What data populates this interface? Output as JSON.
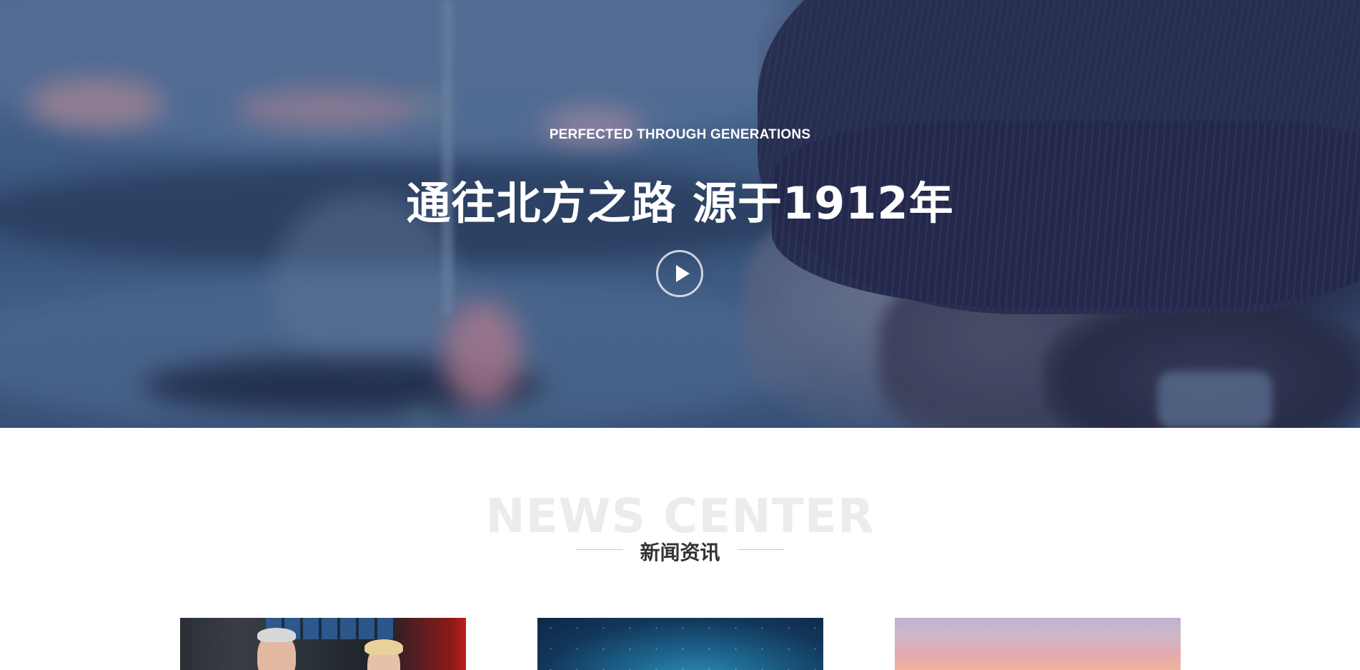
{
  "hero": {
    "kicker": "PERFECTED THROUGH GENERATIONS",
    "title": "通往北方之路  源于1912年",
    "play_icon": "play-icon"
  },
  "news": {
    "title_en": "NEWS CENTER",
    "title_cn": "新闻资讯",
    "cards": [
      {
        "image": "news-studio-anchors-image"
      },
      {
        "image": "night-sky-image"
      },
      {
        "image": "sunset-sky-image"
      }
    ]
  },
  "colors": {
    "hero_text": "#ffffff",
    "news_title_en": "#ececec",
    "news_title_cn": "#333333",
    "rule": "#c8c8c8"
  }
}
